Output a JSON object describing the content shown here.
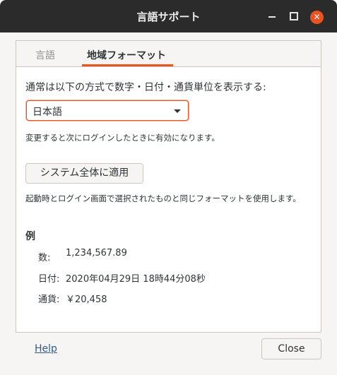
{
  "window": {
    "title": "言語サポート"
  },
  "tabs": [
    {
      "label": "言語",
      "active": false
    },
    {
      "label": "地域フォーマット",
      "active": true
    }
  ],
  "region": {
    "description": "通常は以下の方式で数字・日付・通貨単位を表示する:",
    "format_select": {
      "selected": "日本語"
    },
    "change_note": "変更すると次にログインしたときに有効になります。",
    "apply_button_label": "システム全体に適用",
    "apply_note": "起動時とログイン画面で選択されたものと同じフォーマットを使用します。",
    "example": {
      "heading": "例",
      "number_label": "数:",
      "number_value": "1,234,567.89",
      "date_label": "日付:",
      "date_value": "2020年04月29日 18時44分08秒",
      "currency_label": "通貨:",
      "currency_value": "￥20,458"
    }
  },
  "footer": {
    "help_label": "Help",
    "close_label": "Close"
  },
  "colors": {
    "accent": "#e95420",
    "titlebar": "#2b2b2b"
  }
}
